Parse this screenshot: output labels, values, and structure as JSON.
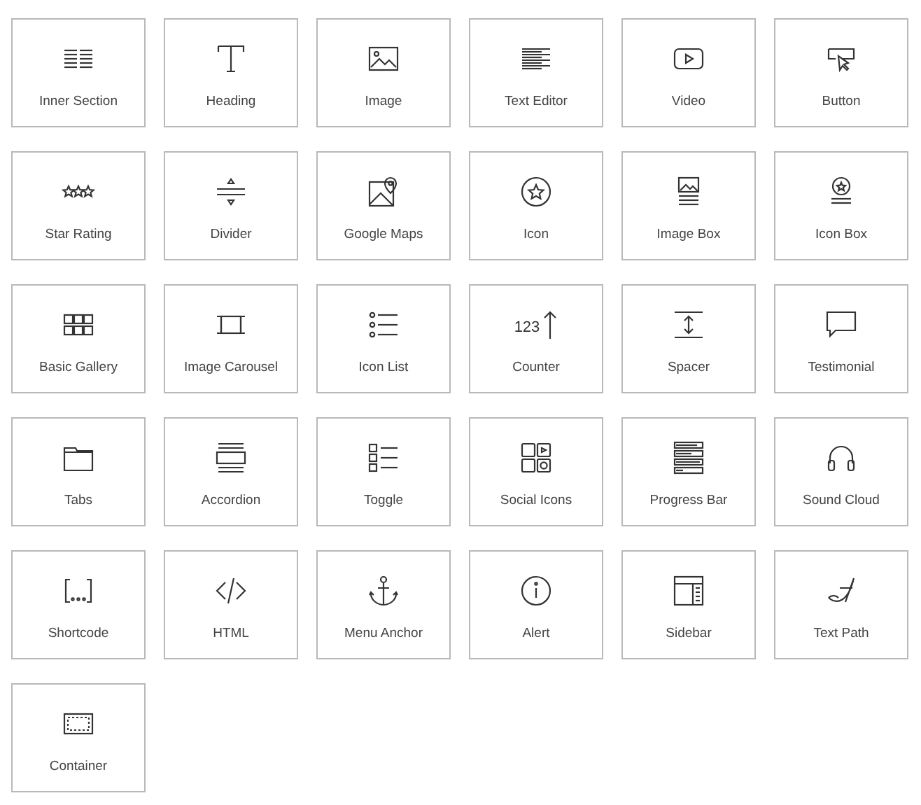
{
  "widgets": [
    {
      "label": "Inner Section"
    },
    {
      "label": "Heading"
    },
    {
      "label": "Image"
    },
    {
      "label": "Text Editor"
    },
    {
      "label": "Video"
    },
    {
      "label": "Button"
    },
    {
      "label": "Star Rating"
    },
    {
      "label": "Divider"
    },
    {
      "label": "Google Maps"
    },
    {
      "label": "Icon"
    },
    {
      "label": "Image Box"
    },
    {
      "label": "Icon Box"
    },
    {
      "label": "Basic Gallery"
    },
    {
      "label": "Image Carousel"
    },
    {
      "label": "Icon List"
    },
    {
      "label": "Counter",
      "icon_text": "123"
    },
    {
      "label": "Spacer"
    },
    {
      "label": "Testimonial"
    },
    {
      "label": "Tabs"
    },
    {
      "label": "Accordion"
    },
    {
      "label": "Toggle"
    },
    {
      "label": "Social Icons"
    },
    {
      "label": "Progress Bar"
    },
    {
      "label": "Sound Cloud"
    },
    {
      "label": "Shortcode"
    },
    {
      "label": "HTML"
    },
    {
      "label": "Menu Anchor"
    },
    {
      "label": "Alert"
    },
    {
      "label": "Sidebar"
    },
    {
      "label": "Text Path"
    },
    {
      "label": "Container"
    }
  ]
}
